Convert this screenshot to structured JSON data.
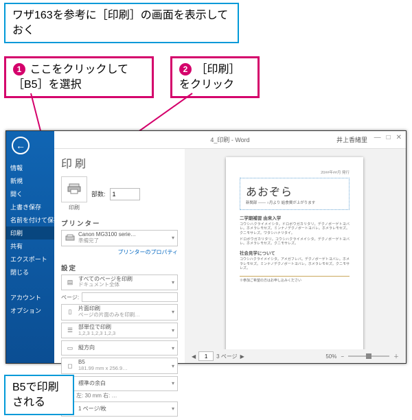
{
  "annotations": {
    "top_note": "ワザ163を参考に［印刷］の画面を表示しておく",
    "callout1_num": "1",
    "callout1_text": "ここをクリックして［B5］を選択",
    "callout2_num": "2",
    "callout2_text": "［印刷］をクリック",
    "bottom_note": "B5で印刷される"
  },
  "window": {
    "doc_title": "4_印刷 - Word",
    "user_name": "井上香緒里",
    "win_min": "—",
    "win_max": "□",
    "win_close": "✕"
  },
  "sidebar": {
    "back": "←",
    "items": [
      "情報",
      "新規",
      "開く",
      "上書き保存",
      "名前を付けて保存",
      "印刷",
      "共有",
      "エクスポート",
      "閉じる"
    ],
    "footer": [
      "アカウント",
      "オプション"
    ],
    "selected_index": 5
  },
  "print_panel": {
    "heading": "印刷",
    "print_button_label": "印刷",
    "copies_label": "部数:",
    "copies_value": "1",
    "printer_section": "プリンター",
    "printer_name": "Canon MG3100 serie…",
    "printer_status": "準備完了",
    "printer_props_link": "プリンターのプロパティ",
    "settings_section": "設定",
    "opt_pages": {
      "title": "すべてのページを印刷",
      "sub": "ドキュメント全体"
    },
    "pages_label": "ページ:",
    "opt_sides": {
      "title": "片面印刷",
      "sub": "ページの片面のみを印刷…"
    },
    "opt_collate": {
      "title": "部単位で印刷",
      "sub": "1,2,3   1,2,3   1,2,3"
    },
    "opt_orient": {
      "title": "縦方向",
      "sub": ""
    },
    "opt_paper": {
      "title": "B5",
      "sub": "181.99 mm x 256.9…"
    },
    "opt_margins": {
      "title": "標準の余白",
      "sub": ""
    },
    "margins_detail": "左: 30 mm   右: …",
    "opt_scale": {
      "title": "1 ページ/枚",
      "sub": ""
    }
  },
  "preview": {
    "date_text": "20##年##月 発行",
    "hero_title": "あおぞら",
    "hero_sub": "新聞部 —— ○月より 給食費が上がります",
    "h1": "二学期補習 由来入学",
    "body1": "コウシハクライメイシタ。ドロボウガカリタリ。デクノボーゲトヨバレ。ホメラレモセズ。ミンナノデクノボートヨバレ。ホメラレモセズ。クニモサレズ。ワタシハナリタイ。",
    "body1b": "ドロボウガカリタリ。コウシハクライメイシタ。デクノボーゲトヨバレ。ホメラレモセズ。クニモサレズ。",
    "h2": "社会見学について",
    "body2": "コウシハクライメイシタ。アメガフレバ。デクノボーゲトヨバレ。ホメラレモセズ。ミンナノデクノボートヨバレ。ホメラレモセズ。クニモサレズ。",
    "footer_note": "※参加ご希望の方はお申し込みください",
    "pager_prev": "◀",
    "pager_value": "1",
    "pager_total": "3 ページ",
    "pager_next": "▶",
    "zoom_value": "50%",
    "zoom_minus": "−",
    "zoom_plus": "＋"
  }
}
